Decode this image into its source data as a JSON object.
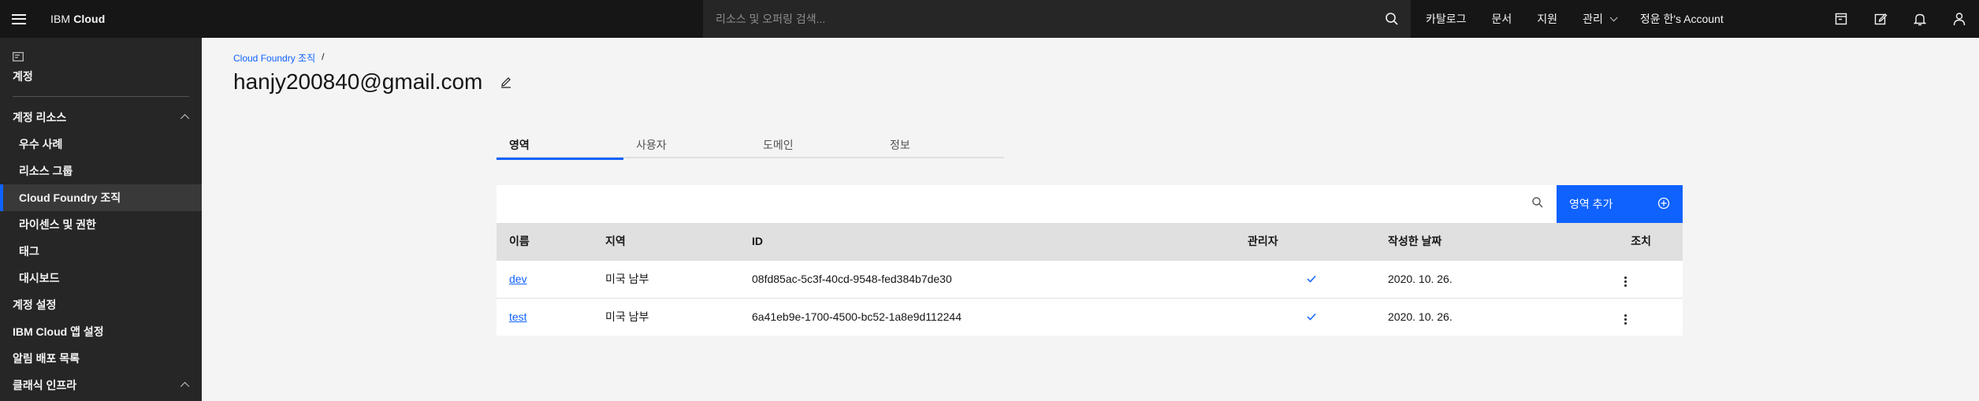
{
  "header": {
    "brand_prefix": "IBM",
    "brand_name": "Cloud",
    "search_placeholder": "리소스 및 오퍼링 검색...",
    "nav": [
      "카탈로그",
      "문서",
      "지원",
      "관리"
    ],
    "account": "정윤 한's Account"
  },
  "sidebar": {
    "home_label": "계정",
    "account_resources": {
      "label": "계정 리소스",
      "items": [
        "우수 사례",
        "리소스 그룹",
        "Cloud Foundry 조직",
        "라이센스 및 권한",
        "태그",
        "대시보드"
      ]
    },
    "top_items": [
      "계정 설정",
      "IBM Cloud 앱 설정",
      "알림 배포 목록"
    ],
    "classic_section": "클래식 인프라"
  },
  "breadcrumb": {
    "parent": "Cloud Foundry 조직",
    "sep": "/"
  },
  "page_title": "hanjy200840@gmail.com",
  "tabs": [
    "영역",
    "사용자",
    "도메인",
    "정보"
  ],
  "toolbar": {
    "add_label": "영역 추가"
  },
  "table": {
    "headers": [
      "이름",
      "지역",
      "ID",
      "관리자",
      "작성한 날짜",
      "조치"
    ],
    "rows": [
      {
        "name": "dev",
        "region": "미국 남부",
        "id": "08fd85ac-5c3f-40cd-9548-fed384b7de30",
        "admin": true,
        "date": "2020. 10. 26."
      },
      {
        "name": "test",
        "region": "미국 남부",
        "id": "6a41eb9e-1700-4500-bc52-1a8e9d112244",
        "admin": true,
        "date": "2020. 10. 26."
      }
    ]
  },
  "colors": {
    "accent": "#0f62fe",
    "header_bg": "#161616",
    "sidebar_bg": "#262626",
    "page_bg": "#f4f4f4",
    "check": "#0f62fe"
  }
}
